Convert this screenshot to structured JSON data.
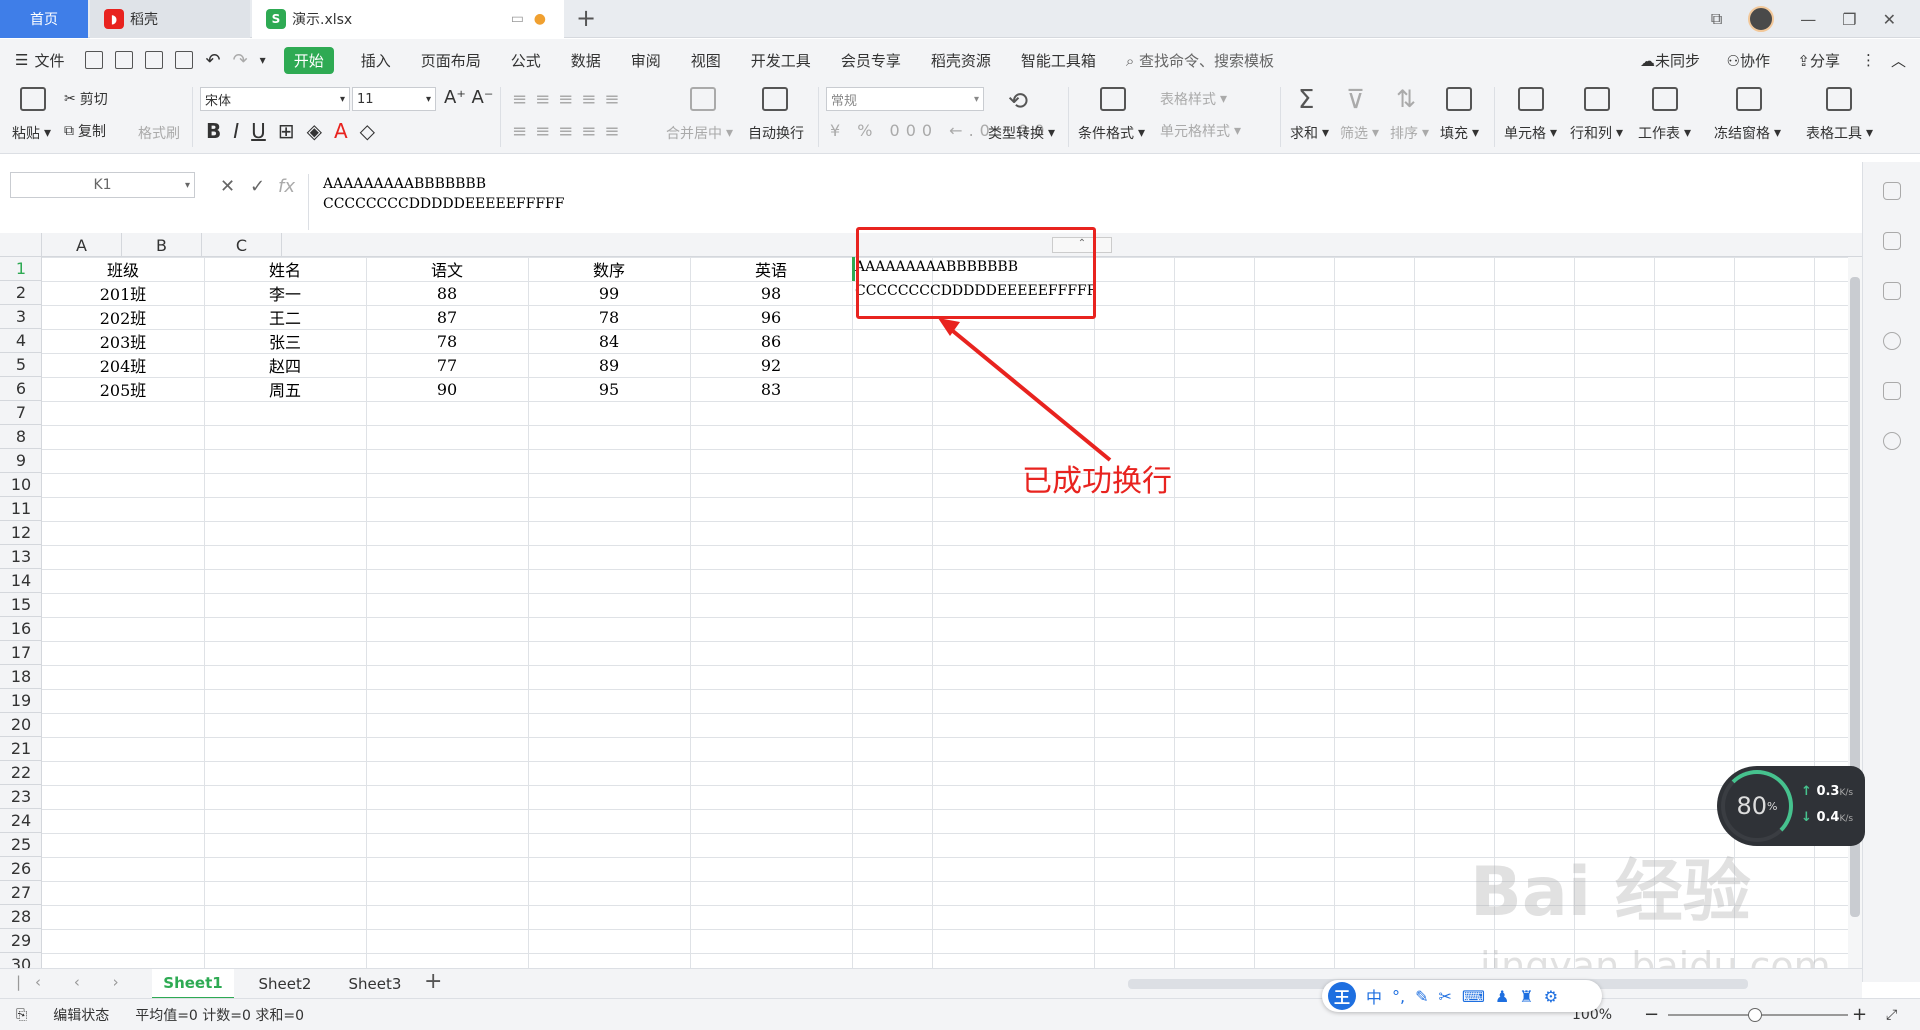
{
  "tabs": {
    "home": "首页",
    "daoke": "稻壳",
    "file": "演示.xlsx"
  },
  "menu": {
    "file": "文件",
    "items": [
      "开始",
      "插入",
      "页面布局",
      "公式",
      "数据",
      "审阅",
      "视图",
      "开发工具",
      "会员专享",
      "稻壳资源",
      "智能工具箱"
    ],
    "search": "查找命令、搜索模板",
    "unsynced": "未同步",
    "collab": "协作",
    "share": "分享"
  },
  "ribbon": {
    "paste": "粘贴",
    "cut": "剪切",
    "copy": "复制",
    "format_painter": "格式刷",
    "font": "宋体",
    "size": "11",
    "merge": "合并居中",
    "wrap": "自动换行",
    "number_format": "常规",
    "type_convert": "类型转换",
    "cond_format": "条件格式",
    "table_style": "表格样式",
    "cell_style": "单元格样式",
    "sum": "求和",
    "filter": "筛选",
    "sort": "排序",
    "fill": "填充",
    "cell": "单元格",
    "rowcol": "行和列",
    "worksheet": "工作表",
    "freeze": "冻结窗格",
    "table_tools": "表格工具"
  },
  "formula": {
    "namebox": "K1",
    "line1": "AAAAAAAAABBBBBBB",
    "line2": "CCCCCCCCDDDDDEEEEEFFFFF"
  },
  "columns": [
    "A",
    "B",
    "C"
  ],
  "rows": [
    "1",
    "2",
    "3",
    "4",
    "5",
    "6",
    "7",
    "8",
    "9",
    "10",
    "11",
    "12",
    "13",
    "14",
    "15",
    "16",
    "17",
    "18",
    "19",
    "20",
    "21",
    "22",
    "23",
    "24",
    "25",
    "26",
    "27",
    "28",
    "29",
    "30"
  ],
  "table": {
    "headers": [
      "班级",
      "姓名",
      "语文",
      "数序",
      "英语"
    ],
    "data": [
      [
        "201班",
        "李一",
        "88",
        "99",
        "98"
      ],
      [
        "202班",
        "王二",
        "87",
        "78",
        "96"
      ],
      [
        "203班",
        "张三",
        "78",
        "84",
        "86"
      ],
      [
        "204班",
        "赵四",
        "77",
        "89",
        "92"
      ],
      [
        "205班",
        "周五",
        "90",
        "95",
        "83"
      ]
    ]
  },
  "cell_k1": {
    "line1": "AAAAAAAAABBBBBBB",
    "line2": "CCCCCCCCDDDDDEEEEEFFFFF"
  },
  "annotation": "已成功换行",
  "sheets": [
    "Sheet1",
    "Sheet2",
    "Sheet3"
  ],
  "status": {
    "mode": "编辑状态",
    "stats": "平均值=0 计数=0 求和=0",
    "zoom": "100%"
  },
  "speed_widget": {
    "percent": "80",
    "unit": "%",
    "up": "0.3",
    "down": "0.4",
    "rate_unit": "K/s"
  },
  "ime": {
    "logo": "王",
    "lang": "中"
  },
  "watermark": {
    "brand": "Bai 经验",
    "url": "jingyan.baidu.com"
  },
  "colors": {
    "accent_green": "#2eaa53",
    "tab_blue": "#3f7ee8",
    "annotation_red": "#e8231f"
  }
}
